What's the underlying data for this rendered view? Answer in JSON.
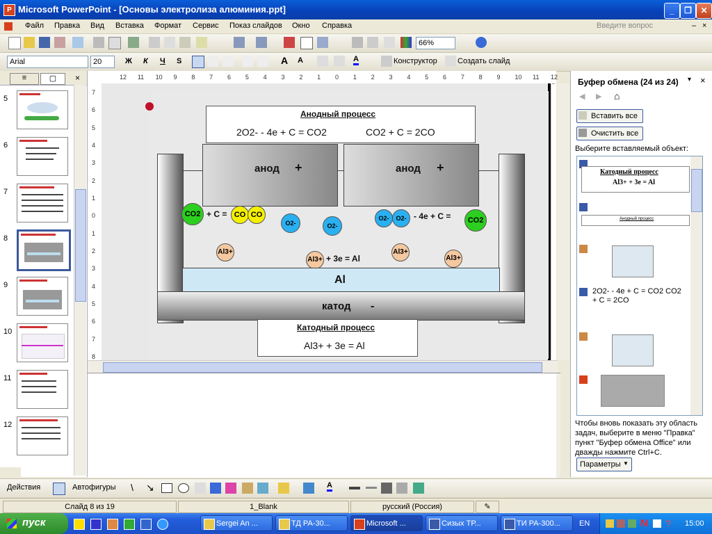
{
  "window": {
    "title": "Microsoft PowerPoint - [Основы электролиза алюминия.ppt]",
    "app_icon": "P"
  },
  "menu": [
    "Файл",
    "Правка",
    "Вид",
    "Вставка",
    "Формат",
    "Сервис",
    "Показ слайдов",
    "Окно",
    "Справка"
  ],
  "help_box": "Введите вопрос",
  "standard_toolbar": {
    "zoom": "66%"
  },
  "format_toolbar": {
    "font": "Arial",
    "size": "20",
    "bold": "Ж",
    "italic": "К",
    "underline": "Ч",
    "shadow": "S",
    "designer": "Конструктор",
    "new_slide": "Создать слайд"
  },
  "slides": [
    {
      "num": "5",
      "kind": "diagram"
    },
    {
      "num": "6",
      "kind": "text"
    },
    {
      "num": "7",
      "kind": "list"
    },
    {
      "num": "8",
      "kind": "electrolysis",
      "selected": true
    },
    {
      "num": "9",
      "kind": "electrolysis"
    },
    {
      "num": "10",
      "kind": "chart"
    },
    {
      "num": "11",
      "kind": "list"
    },
    {
      "num": "12",
      "kind": "list"
    }
  ],
  "ruler_h": [
    "12",
    "11",
    "10",
    "9",
    "8",
    "7",
    "6",
    "5",
    "4",
    "3",
    "2",
    "1",
    "0",
    "1",
    "2",
    "3",
    "4",
    "5",
    "6",
    "7",
    "8",
    "9",
    "10",
    "11",
    "12"
  ],
  "ruler_v": [
    "7",
    "6",
    "5",
    "4",
    "3",
    "2",
    "1",
    "0",
    "1",
    "2",
    "3",
    "4",
    "5",
    "6",
    "7",
    "8"
  ],
  "slide": {
    "anode_title": "Анодный процесс",
    "anode_eq1": "2O2- - 4e + C = CO2",
    "anode_eq2": "CO2 + C = 2CO",
    "anode_label": "анод",
    "plus": "+",
    "co2": "CO2",
    "plus_c_eq": "+ C =",
    "co": "CO",
    "o2": "O2-",
    "minus4e": "- 4e + C =",
    "al3": "Al3+",
    "plus3e_eq": "+ 3e = Al",
    "al_layer": "Al",
    "cathode_label": "катод",
    "minus": "-",
    "cathode_title": "Катодный процесс",
    "cathode_eq": "Al3+ + 3e = Al"
  },
  "taskpane": {
    "title": "Буфер обмена (24 из 24)",
    "paste_all": "Вставить все",
    "clear_all": "Очистить все",
    "select_prompt": "Выберите вставляемый объект:",
    "items": [
      {
        "type": "word",
        "preview_title": "Катодный процесс",
        "preview_eq": "Al3+ + 3e = Al"
      },
      {
        "type": "word",
        "preview_title": "Анодный процесс"
      },
      {
        "type": "picture"
      },
      {
        "type": "word-text",
        "text": "2O2- - 4e + C = CO2 CO2 + C = 2CO"
      },
      {
        "type": "picture"
      },
      {
        "type": "ppt-picture"
      }
    ],
    "hint": "Чтобы вновь показать эту область задач, выберите в меню \"Правка\" пункт \"Буфер обмена Office\" или дважды нажмите Ctrl+C.",
    "options": "Параметры"
  },
  "drawbar": {
    "actions": "Действия",
    "autoshapes": "Автофигуры"
  },
  "status": {
    "slide": "Слайд 8 из 19",
    "design": "1_Blank",
    "lang": "русский (Россия)"
  },
  "taskbar": {
    "start": "пуск",
    "buttons": [
      "Sergei An ...",
      "ТД РА-30...",
      "Microsoft ...",
      "Сизых ТР...",
      "ТИ РА-300..."
    ],
    "lang": "EN",
    "clock": "15:00"
  }
}
